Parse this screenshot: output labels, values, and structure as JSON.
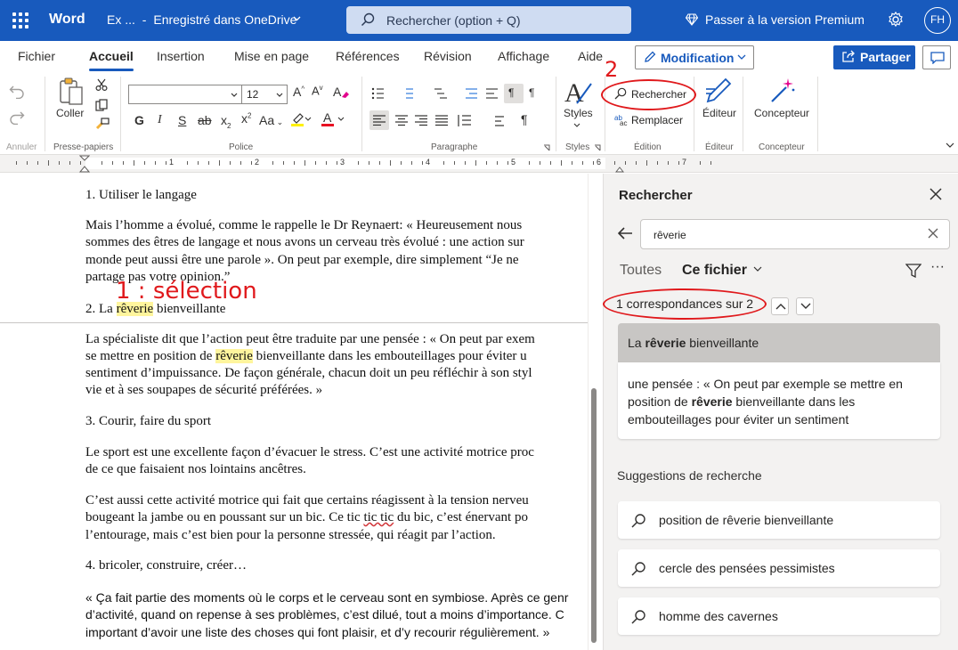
{
  "titlebar": {
    "app": "Word",
    "doc_name": "Ex ...",
    "save_status": "Enregistré dans OneDrive",
    "search_placeholder": "Rechercher (option + Q)",
    "premium": "Passer à la version Premium",
    "avatar": "FH"
  },
  "tabs": [
    "Fichier",
    "Accueil",
    "Insertion",
    "Mise en page",
    "Références",
    "Révision",
    "Affichage",
    "Aide"
  ],
  "active_tab": "Accueil",
  "mode_button": "Modification",
  "share_button": "Partager",
  "ribbon": {
    "undo_label": "Annuler",
    "clipboard": {
      "paste": "Coller",
      "group": "Presse-papiers"
    },
    "font": {
      "size": "12",
      "bold": "G",
      "italic": "I",
      "underline": "S",
      "strike": "ab",
      "group": "Police"
    },
    "paragraph_group": "Paragraphe",
    "styles": {
      "label": "Styles",
      "group": "Styles"
    },
    "edit": {
      "find": "Rechercher",
      "replace": "Remplacer",
      "group": "Édition"
    },
    "editor": {
      "label": "Éditeur",
      "group": "Éditeur"
    },
    "designer": {
      "label": "Concepteur",
      "group": "Concepteur"
    }
  },
  "ruler": {
    "numbers": [
      "1",
      "2",
      "3",
      "4",
      "5",
      "6",
      "7"
    ]
  },
  "document": {
    "h1": "1. Utiliser le langage",
    "p1": [
      "Mais l’homme a évolué, comme le rappelle le Dr Reynaert: « Heureusement nous",
      "sommes des êtres de langage et nous avons un cerveau très évolué : une action sur",
      "monde peut aussi être une parole ». On peut par exemple, dire simplement “Je ne",
      "partage pas votre opinion.”"
    ],
    "h2": {
      "before": "2. La ",
      "match": "rêverie",
      "after": " bienveillante"
    },
    "p2": {
      "line1": "La spécialiste dit que l’action peut être traduite par une pensée : « On peut par exem",
      "line2_before": "se mettre en position de ",
      "line2_match": "rêverie",
      "line2_after": " bienveillante dans les embouteillages pour éviter u",
      "line3": "sentiment d’impuissance. De façon générale, chacun doit un peu réfléchir à son styl",
      "line4": "vie et à ses soupapes de sécurité préférées. »"
    },
    "h3": "3. Courir, faire du sport",
    "p3": [
      "Le sport est une excellente façon d’évacuer le stress. C’est une activité motrice proc",
      "de ce que faisaient nos lointains ancêtres."
    ],
    "p4": {
      "line1": "C’est aussi cette activité motrice qui fait que certains réagissent à la tension nerveu",
      "line2_before": "bougeant la jambe ou en poussant sur un bic. Ce tic ",
      "line2_err": "tic tic",
      "line2_after": " du bic, c’est énervant po",
      "line3": "l’entourage, mais c’est bien pour la personne stressée, qui réagit par l’action."
    },
    "h4": "4. bricoler, construire, créer…",
    "p5": [
      "« Ça fait partie des moments où le corps et le cerveau sont en symbiose. Après ce genr",
      "d’activité, quand on repense à ses problèmes, c’est dilué, tout a moins d’importance. C",
      "important d’avoir une liste des choses qui font plaisir, et d’y recourir régulièrement. »"
    ]
  },
  "pane": {
    "title": "Rechercher",
    "query": "rêverie",
    "scope_all": "Toutes",
    "scope_file": "Ce fichier",
    "count": "1 correspondances sur 2",
    "result1": {
      "before": "La ",
      "match": "rêverie",
      "after": " bienveillante"
    },
    "result2": {
      "before": "une pensée : « On peut par exemple se mettre en position de ",
      "match": "rêverie",
      "after": " bienveillante dans les embouteillages pour éviter un sentiment"
    },
    "suggestions_title": "Suggestions de recherche",
    "suggestions": [
      "position de rêverie bienveillante",
      "cercle des pensées pessimistes",
      "homme des cavernes"
    ]
  },
  "annotations": {
    "step1": "1 : sélection",
    "step2": "2"
  },
  "colors": {
    "brand": "#185abd",
    "annotation": "#e0191c",
    "highlight": "#fff59d"
  }
}
